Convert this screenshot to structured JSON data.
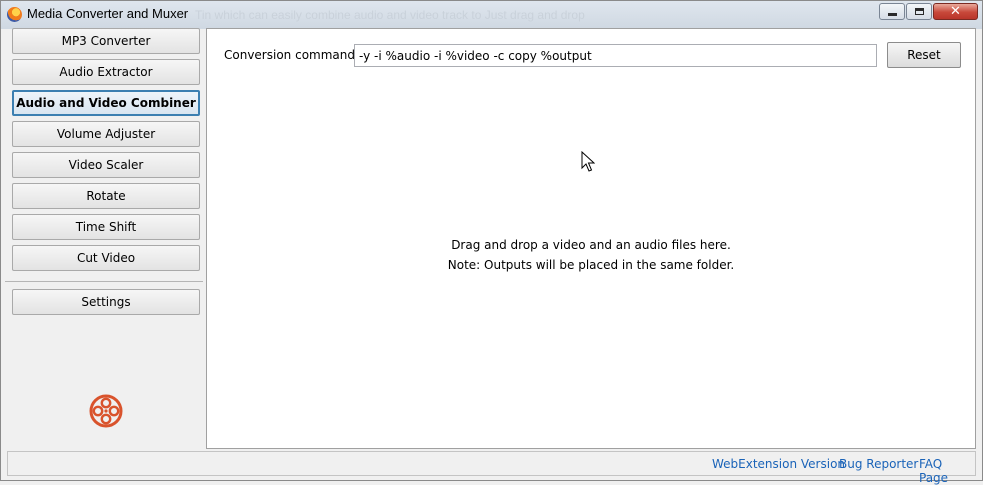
{
  "window": {
    "title": "Media Converter and Muxer",
    "title_overflow_text": "Tin which can easily combine audio and video track to Just drag and drop",
    "controls": {
      "minimize_icon": "minimize-icon",
      "maximize_icon": "maximize-icon",
      "close_icon": "close-icon",
      "close_glyph": "✕"
    }
  },
  "sidebar": {
    "items": [
      {
        "label": "MP3 Converter",
        "active": false
      },
      {
        "label": "Audio Extractor",
        "active": false
      },
      {
        "label": "Audio and Video Combiner",
        "active": true
      },
      {
        "label": "Volume Adjuster",
        "active": false
      },
      {
        "label": "Video Scaler",
        "active": false
      },
      {
        "label": "Rotate",
        "active": false
      },
      {
        "label": "Time Shift",
        "active": false
      },
      {
        "label": "Cut Video",
        "active": false
      }
    ],
    "settings_label": "Settings",
    "logo_icon": "film-reel-icon",
    "logo_color": "#d9532c"
  },
  "main": {
    "command_label": "Conversion command:",
    "command_value": "-y -i %audio -i %video -c copy %output",
    "reset_label": "Reset",
    "drop_line1": "Drag and drop a video and an audio files here.",
    "drop_line2": "Note: Outputs will be placed in the same folder."
  },
  "footer": {
    "links": [
      "WebExtension Version",
      "Bug Reporter",
      "FAQ Page"
    ],
    "link_color": "#1a63b8"
  },
  "colors": {
    "active_border": "#3c7fb1",
    "close_button": "#c8483a"
  }
}
